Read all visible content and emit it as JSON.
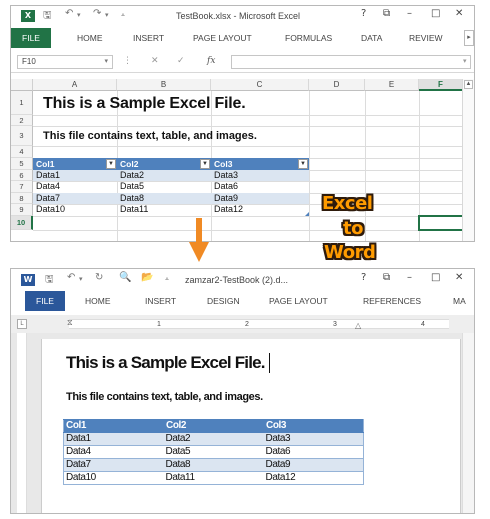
{
  "excel": {
    "app_icon": "X",
    "title": "TestBook.xlsx - Microsoft Excel",
    "window_controls": [
      "?",
      "⧉",
      "–",
      "□",
      "✕"
    ],
    "ribbon_tabs": [
      "FILE",
      "HOME",
      "INSERT",
      "PAGE LAYOUT",
      "FORMULAS",
      "DATA",
      "REVIEW"
    ],
    "ribbon_scroll": "▸",
    "name_box": "F10",
    "fx_symbol": "fx",
    "columns": [
      "A",
      "B",
      "C",
      "D",
      "E",
      "F"
    ],
    "selected_column": "F",
    "rows": [
      "1",
      "2",
      "3",
      "4",
      "5",
      "6",
      "7",
      "8",
      "9",
      "10"
    ],
    "selected_row": "10",
    "cell_a1": "This is a Sample Excel File.",
    "cell_a3": "This file contains text, table, and images.",
    "table_headers": [
      "Col1",
      "Col2",
      "Col3"
    ],
    "table_rows": [
      [
        "Data1",
        "Data2",
        "Data3"
      ],
      [
        "Data4",
        "Data5",
        "Data6"
      ],
      [
        "Data7",
        "Data8",
        "Data9"
      ],
      [
        "Data10",
        "Data11",
        "Data12"
      ]
    ],
    "colors": {
      "accent": "#217346",
      "table_header": "#4f81bd",
      "table_band": "#dbe5f1"
    }
  },
  "overlay": {
    "callout_lines": [
      "Excel",
      "to",
      "Word"
    ],
    "callout_color": "#ff9b00"
  },
  "word": {
    "app_icon": "W",
    "title": "zamzar2-TestBook (2).d...",
    "window_controls": [
      "?",
      "⧉",
      "–",
      "□",
      "✕"
    ],
    "ribbon_tabs": [
      "FILE",
      "HOME",
      "INSERT",
      "DESIGN",
      "PAGE LAYOUT",
      "REFERENCES",
      "MA"
    ],
    "ruler_numbers": [
      "1",
      "2",
      "3",
      "4"
    ],
    "heading": "This is a Sample Excel File.",
    "subheading": "This file contains text, table, and images.",
    "table_headers": [
      "Col1",
      "Col2",
      "Col3"
    ],
    "table_rows": [
      [
        "Data1",
        "Data2",
        "Data3"
      ],
      [
        "Data4",
        "Data5",
        "Data6"
      ],
      [
        "Data7",
        "Data8",
        "Data9"
      ],
      [
        "Data10",
        "Data11",
        "Data12"
      ]
    ],
    "colors": {
      "accent": "#2b579a"
    }
  }
}
